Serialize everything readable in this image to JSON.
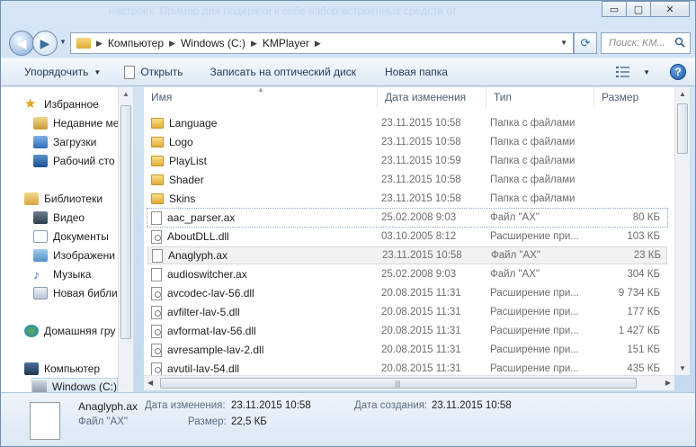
{
  "window": {
    "title_blur": "настроек. Пример для подержки к себе набор встроенных средств от",
    "minimize": "▭",
    "maximize": "▢",
    "close": "✕"
  },
  "nav": {
    "back": "◀",
    "forward": "▶",
    "address": [
      "Компьютер",
      "Windows (C:)",
      "KMPlayer"
    ],
    "search_placeholder": "Поиск: KM..."
  },
  "toolbar": {
    "organize": "Упорядочить",
    "open": "Открыть",
    "burn": "Записать на оптический диск",
    "new_folder": "Новая папка",
    "help": "?"
  },
  "navpane": {
    "items": [
      {
        "label": "Избранное",
        "icon": "star-icon"
      },
      {
        "label": "Недавние ме",
        "icon": "recent-places-icon"
      },
      {
        "label": "Загрузки",
        "icon": "downloads-icon"
      },
      {
        "label": "Рабочий сто",
        "icon": "desktop-icon"
      },
      {
        "label": "Библиотеки",
        "icon": "libraries-icon"
      },
      {
        "label": "Видео",
        "icon": "video-icon"
      },
      {
        "label": "Документы",
        "icon": "documents-icon"
      },
      {
        "label": "Изображени",
        "icon": "pictures-icon"
      },
      {
        "label": "Музыка",
        "icon": "music-icon"
      },
      {
        "label": "Новая библи",
        "icon": "library-icon"
      },
      {
        "label": "Домашняя гру",
        "icon": "homegroup-icon"
      },
      {
        "label": "Компьютер",
        "icon": "computer-icon"
      },
      {
        "label": "Windows (C:)",
        "icon": "drive-icon"
      }
    ]
  },
  "columns": {
    "name": "Имя",
    "date": "Дата изменения",
    "type": "Тип",
    "size": "Размер"
  },
  "files": [
    {
      "name": "Language",
      "date": "23.11.2015 10:58",
      "type": "Папка с файлами",
      "size": "",
      "kind": "folder"
    },
    {
      "name": "Logo",
      "date": "23.11.2015 10:58",
      "type": "Папка с файлами",
      "size": "",
      "kind": "folder"
    },
    {
      "name": "PlayList",
      "date": "23.11.2015 10:59",
      "type": "Папка с файлами",
      "size": "",
      "kind": "folder"
    },
    {
      "name": "Shader",
      "date": "23.11.2015 10:58",
      "type": "Папка с файлами",
      "size": "",
      "kind": "folder"
    },
    {
      "name": "Skins",
      "date": "23.11.2015 10:58",
      "type": "Папка с файлами",
      "size": "",
      "kind": "folder"
    },
    {
      "name": "aac_parser.ax",
      "date": "25.02.2008 9:03",
      "type": "Файл \"AX\"",
      "size": "80 КБ",
      "kind": "ax"
    },
    {
      "name": "AboutDLL.dll",
      "date": "03.10.2005 8:12",
      "type": "Расширение при...",
      "size": "103 КБ",
      "kind": "dll"
    },
    {
      "name": "Anaglyph.ax",
      "date": "23.11.2015 10:58",
      "type": "Файл \"AX\"",
      "size": "23 КБ",
      "kind": "ax"
    },
    {
      "name": "audioswitcher.ax",
      "date": "25.02.2008 9:03",
      "type": "Файл \"AX\"",
      "size": "304 КБ",
      "kind": "ax"
    },
    {
      "name": "avcodec-lav-56.dll",
      "date": "20.08.2015 11:31",
      "type": "Расширение при...",
      "size": "9 734 КБ",
      "kind": "dll"
    },
    {
      "name": "avfilter-lav-5.dll",
      "date": "20.08.2015 11:31",
      "type": "Расширение при...",
      "size": "177 КБ",
      "kind": "dll"
    },
    {
      "name": "avformat-lav-56.dll",
      "date": "20.08.2015 11:31",
      "type": "Расширение при...",
      "size": "1 427 КБ",
      "kind": "dll"
    },
    {
      "name": "avresample-lav-2.dll",
      "date": "20.08.2015 11:31",
      "type": "Расширение при...",
      "size": "151 КБ",
      "kind": "dll"
    },
    {
      "name": "avutil-lav-54.dll",
      "date": "20.08.2015 11:31",
      "type": "Расширение при...",
      "size": "435 КБ",
      "kind": "dll"
    }
  ],
  "details": {
    "name": "Anaglyph.ax",
    "type": "Файл \"AX\"",
    "modified_label": "Дата изменения:",
    "modified_value": "23.11.2015 10:58",
    "created_label": "Дата создания:",
    "created_value": "23.11.2015 10:58",
    "size_label": "Размер:",
    "size_value": "22,5 КБ"
  }
}
